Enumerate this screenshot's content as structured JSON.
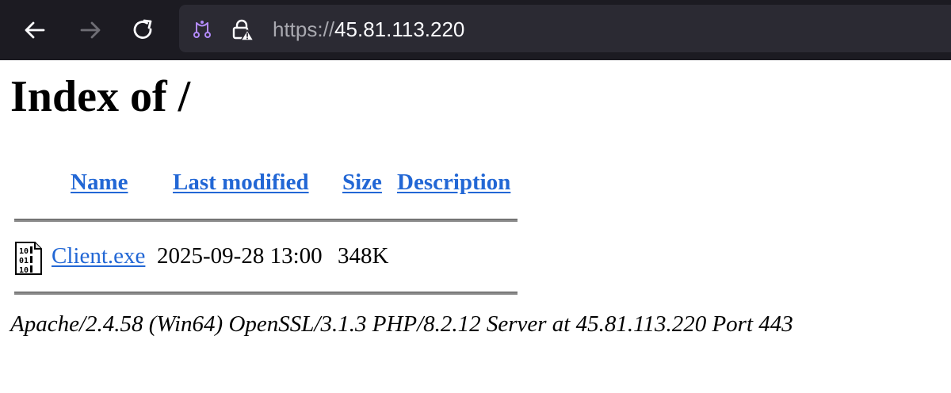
{
  "browser": {
    "url_scheme": "https://",
    "url_host": "45.81.113.220",
    "icons": {
      "back": "arrow-left-icon",
      "forward": "arrow-right-icon",
      "reload": "reload-icon",
      "permissions": "permissions-icon",
      "security": "lock-warning-icon"
    },
    "forward_disabled": true
  },
  "page": {
    "title": "Index of /",
    "columns": {
      "name": "Name",
      "last_modified": "Last modified",
      "size": "Size",
      "description": "Description"
    },
    "files": [
      {
        "icon": "binary-file-icon",
        "name": "Client.exe",
        "last_modified": "2025-09-28 13:00",
        "size": "348K",
        "description": ""
      }
    ],
    "server_signature": "Apache/2.4.58 (Win64) OpenSSL/3.1.3 PHP/8.2.12 Server at 45.81.113.220 Port 443"
  },
  "colors": {
    "toolbar_bg": "#1c1b22",
    "urlbar_bg": "#2b2a33",
    "link": "#2267d5",
    "permissions_accent": "#b38bfc"
  }
}
